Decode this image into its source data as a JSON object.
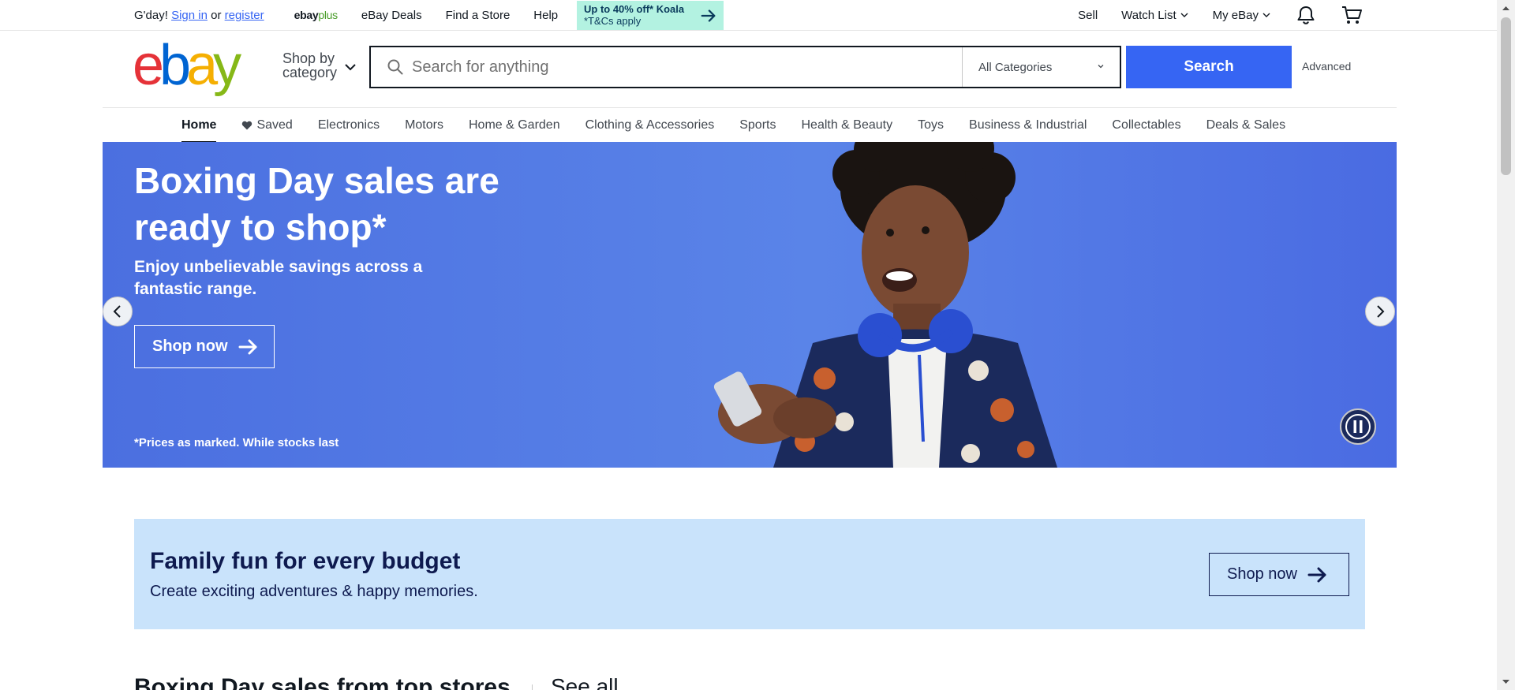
{
  "topbar": {
    "greeting": "G'day!",
    "sign_in": "Sign in",
    "or": "or",
    "register": "register",
    "ebay_plus_brand": "ebay",
    "ebay_plus_suffix": "plus",
    "links": [
      "eBay Deals",
      "Find a Store",
      "Help"
    ],
    "promo_line1": "Up to 40% off* Koala",
    "promo_line2": "*T&Cs apply",
    "sell": "Sell",
    "watch_list": "Watch List",
    "my_ebay": "My eBay"
  },
  "header": {
    "logo_letters": [
      "e",
      "b",
      "a",
      "y"
    ],
    "shop_by_line1": "Shop by",
    "shop_by_line2": "category",
    "search_placeholder": "Search for anything",
    "search_value": "",
    "category_selected": "All Categories",
    "search_button": "Search",
    "advanced": "Advanced"
  },
  "catnav": {
    "items": [
      "Home",
      "Saved",
      "Electronics",
      "Motors",
      "Home & Garden",
      "Clothing & Accessories",
      "Sports",
      "Health & Beauty",
      "Toys",
      "Business & Industrial",
      "Collectables",
      "Deals & Sales"
    ],
    "active": "Home"
  },
  "hero": {
    "title": "Boxing Day sales are ready to shop*",
    "subtitle": "Enjoy unbelievable savings across a fantastic range.",
    "cta": "Shop now",
    "fineprint": "*Prices as marked. While stocks last"
  },
  "family": {
    "title": "Family fun for every budget",
    "subtitle": "Create exciting adventures & happy memories.",
    "cta": "Shop now"
  },
  "section": {
    "title": "Boxing Day sales from top stores",
    "see_all": "See all"
  },
  "colors": {
    "accent": "#3665f3",
    "hero_bg": "#5a84e8",
    "banner_bg": "#c9e3fb",
    "promo_bg": "#b3f2e1"
  }
}
